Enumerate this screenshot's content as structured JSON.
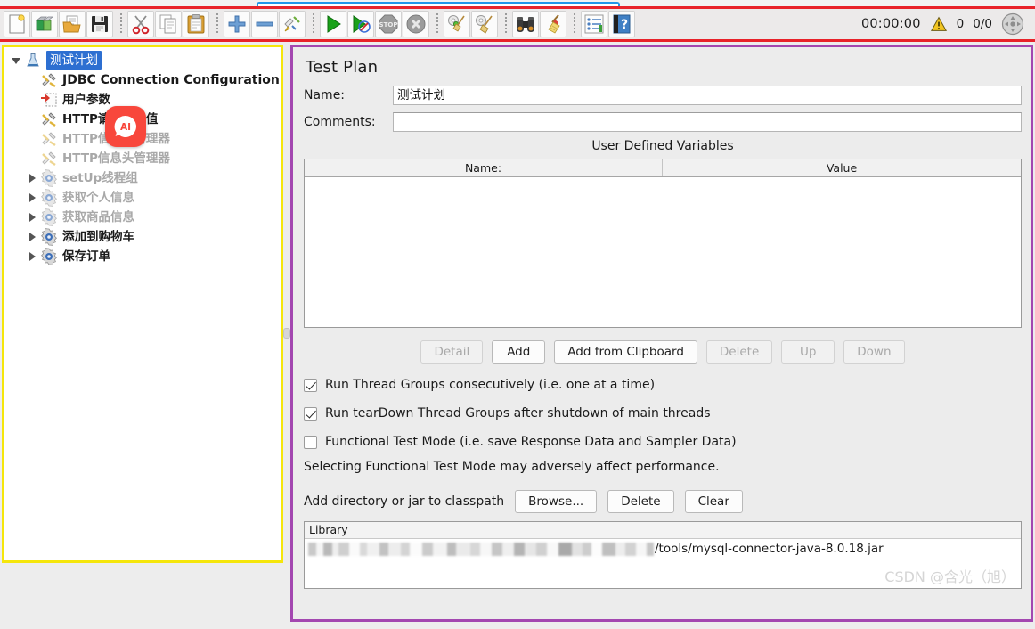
{
  "toolbar": {
    "buttons": [
      {
        "name": "new-button",
        "icon": "new-document-icon",
        "label": "New"
      },
      {
        "name": "templates-button",
        "icon": "templates-icon",
        "label": "Templates"
      },
      {
        "name": "open-button",
        "icon": "open-folder-icon",
        "label": "Open"
      },
      {
        "name": "save-button",
        "icon": "floppy-disk-icon",
        "label": "Save"
      },
      {
        "name": "cut-button",
        "icon": "scissors-icon",
        "label": "Cut"
      },
      {
        "name": "copy-button",
        "icon": "copy-icon",
        "label": "Copy"
      },
      {
        "name": "paste-button",
        "icon": "clipboard-icon",
        "label": "Paste"
      },
      {
        "name": "expand-all-button",
        "icon": "plus-icon",
        "label": "Expand All"
      },
      {
        "name": "collapse-all-button",
        "icon": "minus-icon",
        "label": "Collapse All"
      },
      {
        "name": "toggle-button",
        "icon": "toggle-pin-icon",
        "label": "Toggle"
      },
      {
        "name": "start-button",
        "icon": "play-green-icon",
        "label": "Start"
      },
      {
        "name": "start-no-pauses-button",
        "icon": "play-no-pause-icon",
        "label": "Start no pauses"
      },
      {
        "name": "stop-button",
        "icon": "stop-sign-icon",
        "label": "Stop"
      },
      {
        "name": "shutdown-button",
        "icon": "shutdown-x-icon",
        "label": "Shutdown"
      },
      {
        "name": "clear-button",
        "icon": "broom-gear-green-icon",
        "label": "Clear"
      },
      {
        "name": "clear-all-button",
        "icon": "broom-gear-icon",
        "label": "Clear All"
      },
      {
        "name": "search-button",
        "icon": "binoculars-icon",
        "label": "Search"
      },
      {
        "name": "reset-search-button",
        "icon": "broom-icon",
        "label": "Reset Search"
      },
      {
        "name": "function-helper-button",
        "icon": "list-icon",
        "label": "Function Helper Dialog"
      },
      {
        "name": "help-button",
        "icon": "help-book-icon",
        "label": "Help"
      }
    ],
    "status": {
      "timer": "00:00:00",
      "warning_icon": "warning-triangle-icon",
      "warning_count": "0",
      "thread_counts": "0/0",
      "activity_icon": "activity-indicator-icon"
    }
  },
  "tree": {
    "nodes": [
      {
        "label": "测试计划",
        "icon": "test-plan-icon",
        "indent": 0,
        "twisty": "down",
        "state": "selected"
      },
      {
        "label": "JDBC Connection Configuration",
        "icon": "config-element-icon",
        "indent": 1,
        "twisty": "none",
        "state": "enabled-en"
      },
      {
        "label": "用户参数",
        "icon": "user-parameters-icon",
        "indent": 1,
        "twisty": "none",
        "state": "enabled"
      },
      {
        "label": "HTTP请求默认值",
        "icon": "config-element-icon",
        "indent": 1,
        "twisty": "none",
        "state": "enabled"
      },
      {
        "label": "HTTP信息头管理器",
        "icon": "config-element-icon",
        "indent": 1,
        "twisty": "none",
        "state": "disabled"
      },
      {
        "label": "HTTP信息头管理器",
        "icon": "config-element-icon",
        "indent": 1,
        "twisty": "none",
        "state": "disabled"
      },
      {
        "label": "setUp线程组",
        "icon": "thread-group-icon",
        "indent": 1,
        "twisty": "right",
        "state": "disabled"
      },
      {
        "label": "获取个人信息",
        "icon": "thread-group-icon",
        "indent": 1,
        "twisty": "right",
        "state": "disabled"
      },
      {
        "label": "获取商品信息",
        "icon": "thread-group-icon",
        "indent": 1,
        "twisty": "right",
        "state": "disabled"
      },
      {
        "label": "添加到购物车",
        "icon": "thread-group-icon",
        "indent": 1,
        "twisty": "right",
        "state": "enabled"
      },
      {
        "label": "保存订单",
        "icon": "thread-group-icon",
        "indent": 1,
        "twisty": "right",
        "state": "enabled"
      }
    ],
    "ai_badge": {
      "name": "ai-assistant-badge",
      "label": "AI"
    }
  },
  "main": {
    "title": "Test Plan",
    "name_label": "Name:",
    "name_value": "测试计划",
    "comments_label": "Comments:",
    "comments_value": "",
    "udv": {
      "title": "User Defined Variables",
      "columns": [
        "Name:",
        "Value"
      ],
      "rows": []
    },
    "table_buttons": [
      {
        "label": "Detail",
        "name": "detail-button",
        "disabled": true
      },
      {
        "label": "Add",
        "name": "add-button",
        "disabled": false
      },
      {
        "label": "Add from Clipboard",
        "name": "add-from-clipboard-button",
        "disabled": false
      },
      {
        "label": "Delete",
        "name": "delete-variable-button",
        "disabled": true
      },
      {
        "label": "Up",
        "name": "move-up-button",
        "disabled": true
      },
      {
        "label": "Down",
        "name": "move-down-button",
        "disabled": true
      }
    ],
    "checkboxes": [
      {
        "label": "Run Thread Groups consecutively (i.e. one at a time)",
        "checked": true,
        "name": "run-consecutively-checkbox"
      },
      {
        "label": "Run tearDown Thread Groups after shutdown of main threads",
        "checked": true,
        "name": "run-teardown-checkbox"
      },
      {
        "label": "Functional Test Mode (i.e. save Response Data and Sampler Data)",
        "checked": false,
        "name": "functional-test-mode-checkbox"
      }
    ],
    "note": "Selecting Functional Test Mode may adversely affect performance.",
    "classpath": {
      "label": "Add directory or jar to classpath",
      "buttons": [
        {
          "label": "Browse...",
          "name": "browse-button"
        },
        {
          "label": "Delete",
          "name": "delete-library-button"
        },
        {
          "label": "Clear",
          "name": "clear-library-button"
        }
      ]
    },
    "library": {
      "header": "Library",
      "rows": [
        {
          "redacted_prefix": true,
          "path": "/tools/mysql-connector-java-8.0.18.jar"
        }
      ]
    },
    "watermark": "CSDN @含光（旭）"
  },
  "colors": {
    "toolbar_outline": "#e8232a",
    "tree_outline": "#f5e60b",
    "panel_outline": "#a347b0",
    "selection": "#2d6fd1",
    "ai_badge": "#f8473c"
  }
}
